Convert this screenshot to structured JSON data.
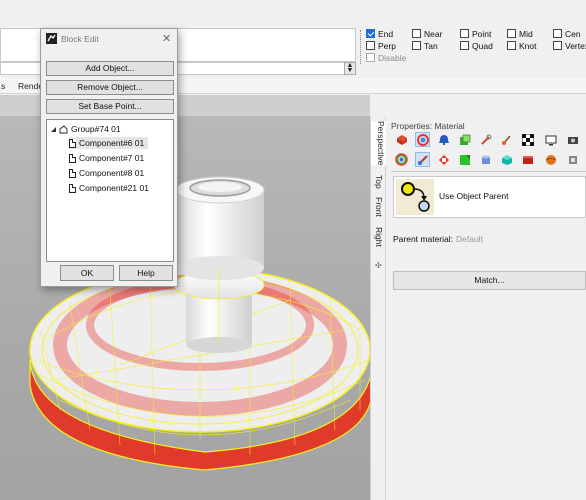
{
  "dialog": {
    "title": "Block Edit",
    "buttons": {
      "add": "Add Object...",
      "remove": "Remove Object...",
      "set_base": "Set Base Point...",
      "ok": "OK",
      "help": "Help"
    },
    "tree": {
      "group": "Group#74 01",
      "children": [
        "Component#6 01",
        "Component#7 01",
        "Component#8 01",
        "Component#21 01"
      ],
      "selected_index": 0
    }
  },
  "osnap": {
    "col1": [
      {
        "label": "End",
        "checked": true
      },
      {
        "label": "Perp",
        "checked": false
      },
      {
        "label": "Disable",
        "checked": false
      }
    ],
    "col2": [
      {
        "label": "Near",
        "checked": false
      },
      {
        "label": "Tan",
        "checked": false
      }
    ],
    "col3": [
      {
        "label": "Point",
        "checked": false
      },
      {
        "label": "Quad",
        "checked": false
      }
    ],
    "col4": [
      {
        "label": "Mid",
        "checked": false
      },
      {
        "label": "Knot",
        "checked": false
      }
    ],
    "col5": [
      {
        "label": "Cen",
        "checked": false
      },
      {
        "label": "Vertex",
        "checked": false
      }
    ]
  },
  "toolbar_tabs": [
    "s",
    "Rende"
  ],
  "view_tabs": [
    "Perspective",
    "Top",
    "Front",
    "Right"
  ],
  "properties": {
    "title": "Properties: Material",
    "use_object_parent": "Use Object Parent",
    "parent_material_label": "Parent material:",
    "parent_material_value": "Default",
    "match_button": "Match..."
  },
  "colors": {
    "accent": "#1b6fd1",
    "wireframe": "#f5f020",
    "highlight": "#e8261c"
  }
}
